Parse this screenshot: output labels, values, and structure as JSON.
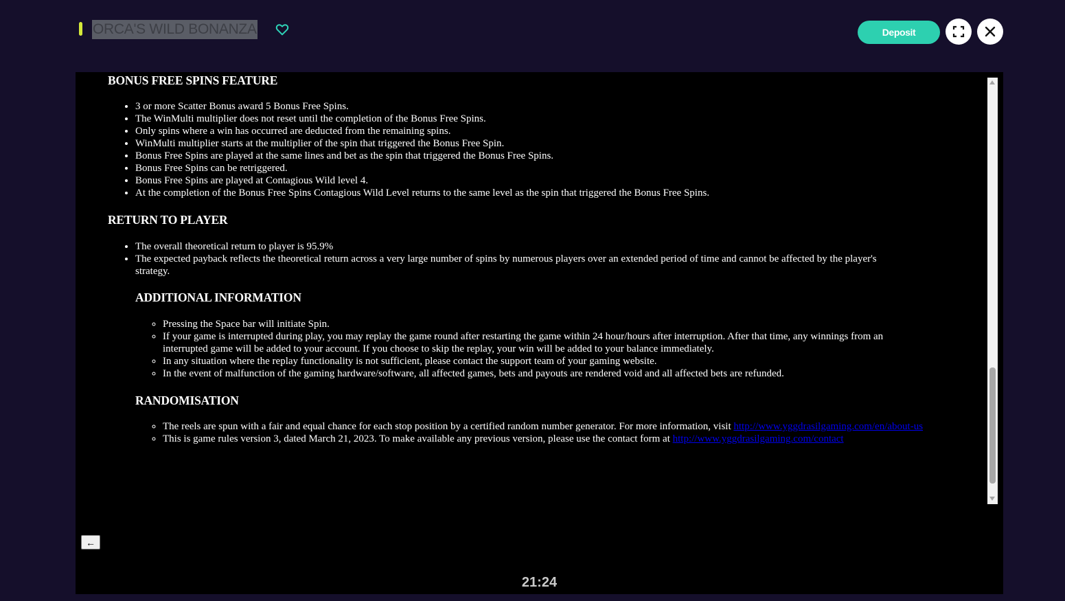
{
  "header": {
    "game_title": "ORCA'S WILD BONANZA",
    "deposit_label": "Deposit",
    "favorite_icon": "heart-outline-icon",
    "fullscreen_icon": "fullscreen-icon",
    "close_icon": "close-icon",
    "colors": {
      "accent": "#d4e83a",
      "deposit": "#2dd0b0",
      "heart": "#2ed3b8",
      "background": "#150f2b"
    }
  },
  "rules": {
    "bonus": {
      "heading": "BONUS FREE SPINS FEATURE",
      "items": [
        "3 or more Scatter Bonus award 5 Bonus Free Spins.",
        "The WinMulti multiplier does not reset until the completion of the Bonus Free Spins.",
        "Only spins where a win has occurred are deducted from the remaining spins.",
        "WinMulti multiplier starts at the multiplier of the spin that triggered the Bonus Free Spin.",
        "Bonus Free Spins are played at the same lines and bet as the spin that triggered the Bonus Free Spins.",
        "Bonus Free Spins can be retriggered.",
        "Bonus Free Spins are played at Contagious Wild level 4.",
        "At the completion of the Bonus Free Spins Contagious Wild Level returns to the same level as the spin that triggered the Bonus Free Spins."
      ]
    },
    "rtp": {
      "heading": "RETURN TO PLAYER",
      "items": [
        "The overall theoretical return to player is 95.9%",
        "The expected payback reflects the theoretical return across a very large number of spins by numerous players over an extended period of time and cannot be affected by the player's strategy."
      ]
    },
    "additional": {
      "heading": "ADDITIONAL INFORMATION",
      "items": [
        "Pressing the Space bar will initiate Spin.",
        "If your game is interrupted during play, you may replay the game round after restarting the game within 24 hour/hours after interruption. After that time, any winnings from an interrupted game will be added to your account. If you choose to skip the replay, your win will be added to your balance immediately.",
        "In any situation where the replay functionality is not sufficient, please contact the support team of your gaming website.",
        "In the event of malfunction of the gaming hardware/software, all affected games, bets and payouts are rendered void and all affected bets are refunded."
      ]
    },
    "randomisation": {
      "heading": "RANDOMISATION",
      "item1_text": "The reels are spun with a fair and equal chance for each stop position by a certified random number generator. For more information, visit ",
      "item1_link": "http://www.yggdrasilgaming.com/en/about-us",
      "item2_text": "This is game rules version 3, dated March 21, 2023. To make available any previous version, please use the contact form at ",
      "item2_link": "http://www.yggdrasilgaming.com/contact"
    }
  },
  "footer": {
    "back_label": "←",
    "clock": "21:24"
  }
}
